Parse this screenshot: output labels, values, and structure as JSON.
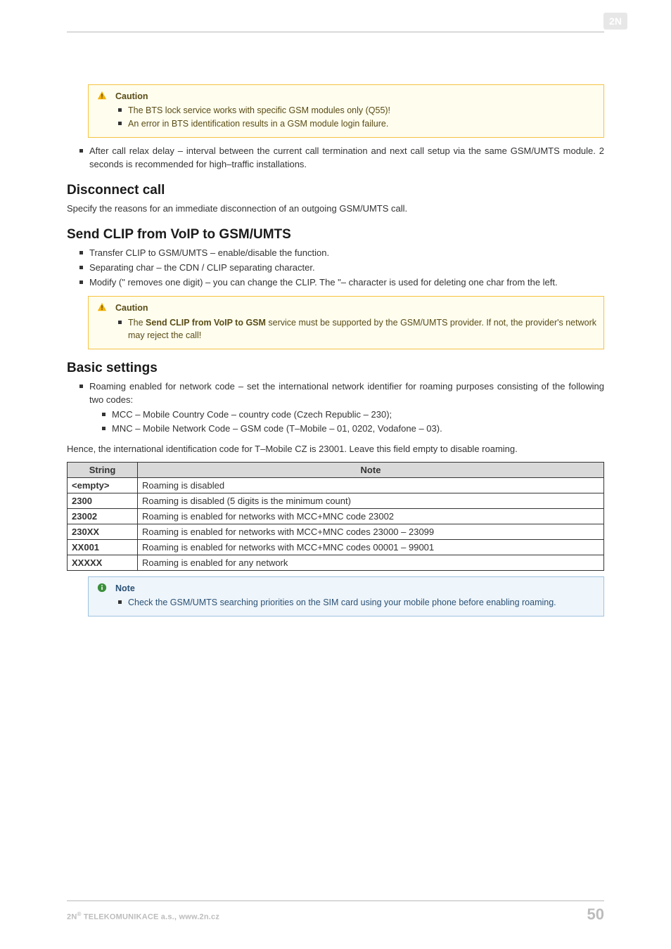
{
  "logo_label": "2N",
  "caution1": {
    "title": "Caution",
    "items": [
      "The BTS lock service works with specific GSM modules only (Q55)!",
      "An error in BTS identification results in a GSM module login failure."
    ]
  },
  "after_call_bullet": "After call relax delay – interval between the current call termination and next call setup via the same GSM/UMTS module. 2 seconds is recommended for high–traffic installations.",
  "disconnect": {
    "heading": "Disconnect call",
    "para": "Specify the reasons for an immediate disconnection of an outgoing GSM/UMTS call."
  },
  "sendclip": {
    "heading": "Send CLIP from VoIP to GSM/UMTS",
    "items": [
      "Transfer CLIP to GSM/UMTS – enable/disable the function.",
      "Separating char – the CDN / CLIP separating character.",
      "Modify (\" removes one digit) – you can change the CLIP. The \"– character is used for deleting one char from the left."
    ]
  },
  "caution2": {
    "title": "Caution",
    "pre": "The ",
    "bold": "Send CLIP from VoIP to GSM",
    "post": " service must be supported by the GSM/UMTS provider. If not, the provider's network may reject the call!"
  },
  "basic": {
    "heading": "Basic settings",
    "roaming_intro": "Roaming enabled for network code – set the international network identifier for roaming purposes consisting of the following two codes:",
    "sub_items": [
      "MCC – Mobile Country Code – country code (Czech Republic – 230);",
      "MNC – Mobile Network Code – GSM code (T–Mobile – 01, 0202, Vodafone – 03)."
    ],
    "para2": "Hence, the international identification code for T–Mobile CZ is 23001. Leave this field empty to disable roaming."
  },
  "table": {
    "header_string": "String",
    "header_note": "Note",
    "rows": [
      {
        "s": "<empty>",
        "n": "Roaming is disabled"
      },
      {
        "s": "2300",
        "n": "Roaming is disabled (5 digits is the minimum count)"
      },
      {
        "s": "23002",
        "n": "Roaming is enabled for networks with MCC+MNC code 23002"
      },
      {
        "s": "230XX",
        "n": "Roaming is enabled for networks with MCC+MNC codes 23000 – 23099"
      },
      {
        "s": "XX001",
        "n": "Roaming is enabled for networks with MCC+MNC codes 00001 – 99001"
      },
      {
        "s": "XXXXX",
        "n": "Roaming is enabled for any network"
      }
    ]
  },
  "note1": {
    "title": "Note",
    "item": "Check the GSM/UMTS searching priorities on the SIM card using your mobile phone before enabling roaming."
  },
  "footer": {
    "company_pre": "2N",
    "company_sup": "®",
    "company_post": " TELEKOMUNIKACE a.s., www.2n.cz",
    "page": "50"
  }
}
